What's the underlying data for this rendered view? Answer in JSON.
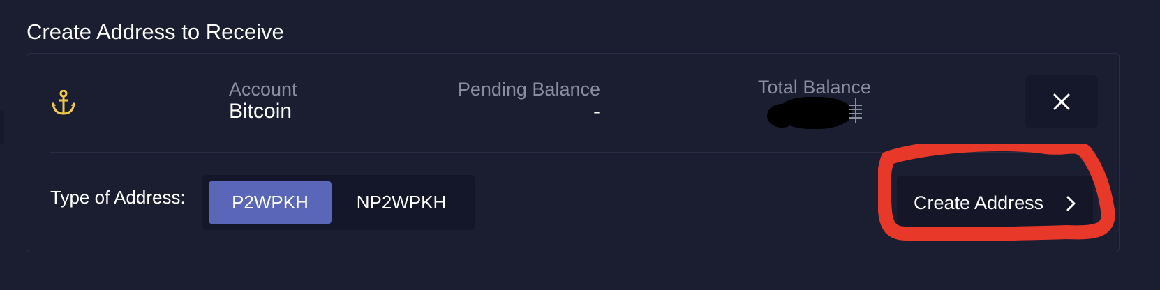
{
  "page": {
    "title": "Create Address to Receive"
  },
  "account_card": {
    "account_label": "Account",
    "account_value": "Bitcoin",
    "pending_label": "Pending Balance",
    "pending_value": "-",
    "total_label": "Total Balance",
    "account_icon": "anchor-icon",
    "total_unit_icon": "bitcoin-unit-icon",
    "close_icon": "close-icon"
  },
  "address_type": {
    "label": "Type of Address:",
    "options": [
      "P2WPKH",
      "NP2WPKH"
    ],
    "selected": "P2WPKH"
  },
  "actions": {
    "create_label": "Create Address",
    "create_icon": "chevron-right-icon"
  },
  "colors": {
    "background": "#1b1e31",
    "accent": "#5a66b8",
    "icon_yellow": "#f2c94c",
    "annotation_red": "#e8382a",
    "muted_text": "#8a8d9e"
  }
}
